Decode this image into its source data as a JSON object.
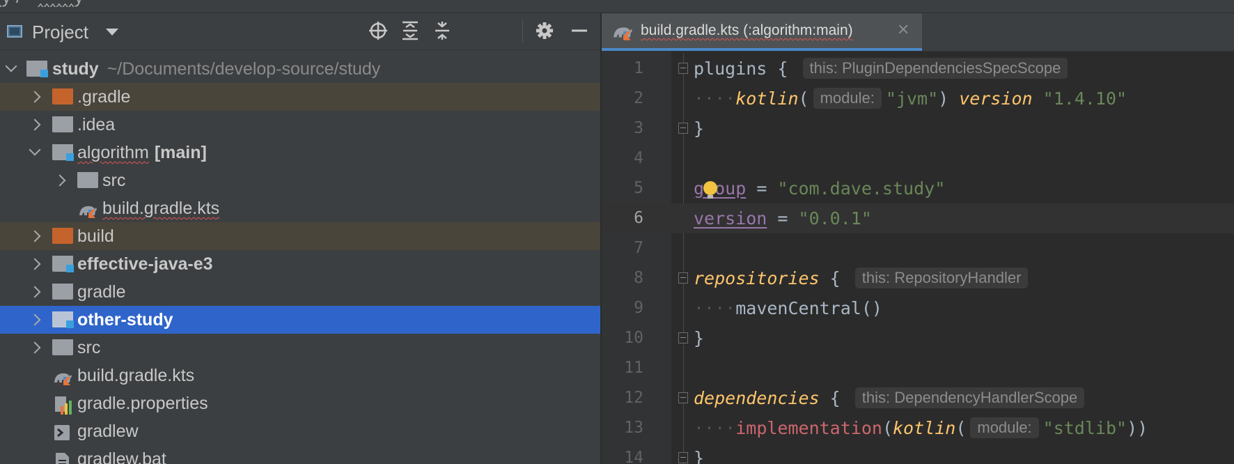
{
  "project_panel": {
    "title": "Project",
    "tree": [
      {
        "label": "study",
        "extra": "~/Documents/develop-source/study",
        "state": "open"
      },
      {
        "label": ".gradle"
      },
      {
        "label": ".idea"
      },
      {
        "label": "algorithm",
        "extra": "[main]",
        "state": "open"
      },
      {
        "label": "src"
      },
      {
        "label": "build.gradle.kts"
      },
      {
        "label": "build"
      },
      {
        "label": "effective-java-e3"
      },
      {
        "label": "gradle"
      },
      {
        "label": "other-study"
      },
      {
        "label": "src"
      },
      {
        "label": "build.gradle.kts"
      },
      {
        "label": "gradle.properties"
      },
      {
        "label": "gradlew"
      },
      {
        "label": "gradlew.bat"
      }
    ]
  },
  "editor": {
    "tab_title": "build.gradle.kts (:algorithm:main)",
    "current_line": 6,
    "code": {
      "plugins": "plugins",
      "plugins_hint": "this: PluginDependenciesSpecScope",
      "kotlin_fn": "kotlin",
      "module_hint": "module:",
      "jvm": "\"jvm\"",
      "version_kw": "version",
      "kotlin_version": "\"1.4.10\"",
      "group": "group",
      "group_value": "\"com.dave.study\"",
      "version": "version",
      "version_value": "\"0.0.1\"",
      "repositories": "repositories",
      "repositories_hint": "this: RepositoryHandler",
      "maven": "mavenCentral()",
      "dependencies": "dependencies",
      "dependencies_hint": "this: DependencyHandlerScope",
      "implementation": "implementation",
      "stdlib": "\"stdlib\""
    }
  },
  "colors": {
    "background": "#2b2b2b",
    "panel": "#3c3f41",
    "selection": "#2f65ca",
    "excluded_row": "#4a453b",
    "keyword": "#ffc66d",
    "string": "#6a8759",
    "property": "#9876aa",
    "module_badge": "#39a0dd",
    "excluded_folder": "#c4642c"
  }
}
